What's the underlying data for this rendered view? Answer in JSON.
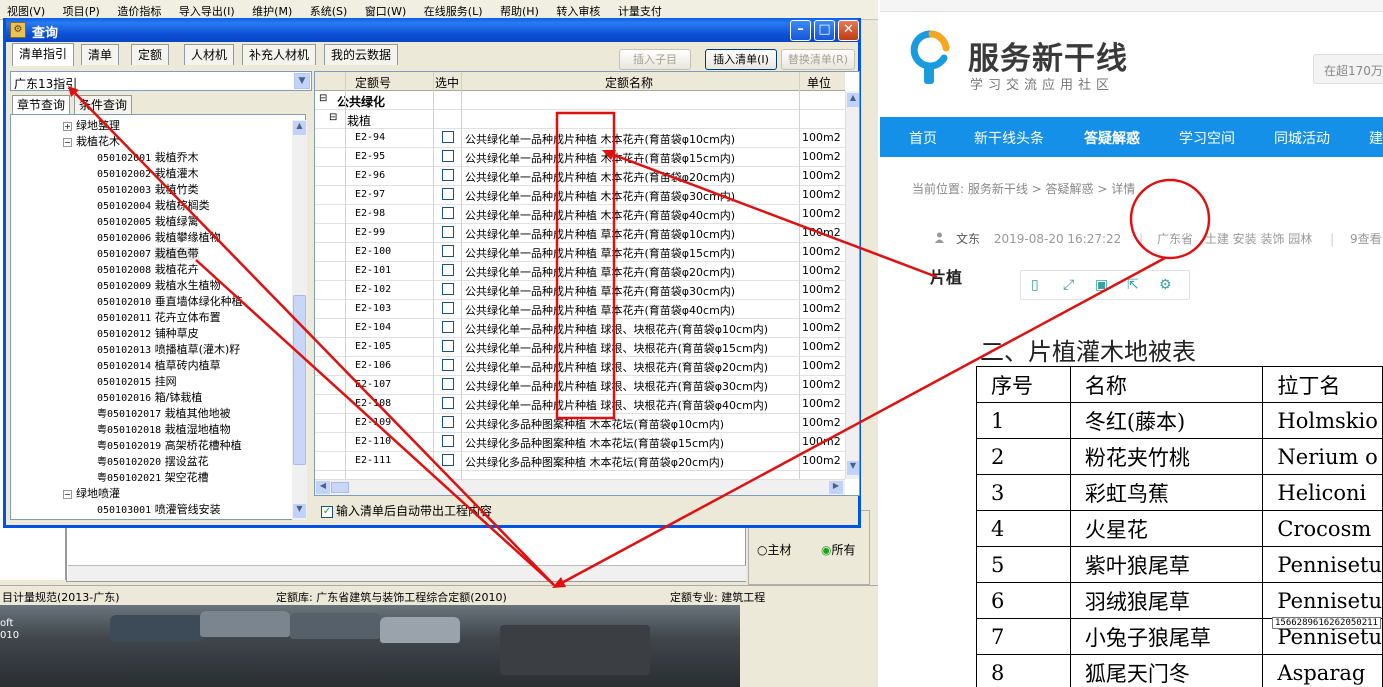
{
  "background_app": {
    "menu": [
      "视图(V)",
      "项目(P)",
      "造价指标",
      "导入导出(I)",
      "维护(M)",
      "系统(S)",
      "窗口(W)",
      "在线服务(L)",
      "帮助(H)",
      "转入审核",
      "计量支付"
    ],
    "status": {
      "left": "目计量规范(2013-广东)",
      "quota_lib": "定额库: 广东省建筑与装饰工程综合定额(2010)",
      "quota_major": "定额专业: 建筑工程"
    },
    "radio_main": "主材",
    "radio_all": "所有",
    "photo_text": [
      "oft",
      "010"
    ]
  },
  "dialog": {
    "title": "查询",
    "tabs": [
      "清单指引",
      "清单",
      "定额",
      "人材机",
      "补充人材机",
      "我的云数据"
    ],
    "buttons": {
      "insert_child": "插入子目",
      "insert_bill": "插入清单(I)",
      "replace_bill": "替换清单(R)"
    },
    "combo_value": "广东13指引",
    "subtabs": [
      "章节查询",
      "条件查询"
    ],
    "tree": [
      {
        "label": "绿地整理",
        "level": 1,
        "toggle": "+"
      },
      {
        "label": "栽植花木",
        "level": 1,
        "toggle": "-"
      },
      {
        "code": "050102001",
        "label": "栽植乔木",
        "level": 2
      },
      {
        "code": "050102002",
        "label": "栽植灌木",
        "level": 2
      },
      {
        "code": "050102003",
        "label": "栽植竹类",
        "level": 2
      },
      {
        "code": "050102004",
        "label": "栽植棕榈类",
        "level": 2
      },
      {
        "code": "050102005",
        "label": "栽植绿篱",
        "level": 2
      },
      {
        "code": "050102006",
        "label": "栽植攀缘植物",
        "level": 2
      },
      {
        "code": "050102007",
        "label": "栽植色带",
        "level": 2,
        "selected": true
      },
      {
        "code": "050102008",
        "label": "栽植花卉",
        "level": 2
      },
      {
        "code": "050102009",
        "label": "栽植水生植物",
        "level": 2
      },
      {
        "code": "050102010",
        "label": "垂直墙体绿化种植",
        "level": 2
      },
      {
        "code": "050102011",
        "label": "花卉立体布置",
        "level": 2
      },
      {
        "code": "050102012",
        "label": "铺种草皮",
        "level": 2
      },
      {
        "code": "050102013",
        "label": "喷播植草(灌木)籽",
        "level": 2
      },
      {
        "code": "050102014",
        "label": "植草砖内植草",
        "level": 2
      },
      {
        "code": "050102015",
        "label": "挂网",
        "level": 2
      },
      {
        "code": "050102016",
        "label": "箱/钵栽植",
        "level": 2
      },
      {
        "code": "粤050102017",
        "label": "栽植其他地被",
        "level": 2
      },
      {
        "code": "粤050102018",
        "label": "栽植湿地植物",
        "level": 2
      },
      {
        "code": "粤050102019",
        "label": "高架桥花槽种植",
        "level": 2
      },
      {
        "code": "粤050102020",
        "label": "摆设盆花",
        "level": 2
      },
      {
        "code": "粤050102021",
        "label": "架空花槽",
        "level": 2
      },
      {
        "label": "绿地喷灌",
        "level": 1,
        "toggle": "-"
      },
      {
        "code": "050103001",
        "label": "喷灌管线安装",
        "level": 2
      }
    ],
    "grid": {
      "headers": [
        "定额号",
        "选中",
        "定额名称",
        "单位"
      ],
      "group": "公共绿化",
      "subgroup": "栽植",
      "rows": [
        {
          "code": "E2-94",
          "name": "公共绿化单一品种成片种植 木本花卉(育苗袋φ10cm内)",
          "unit": "100m2"
        },
        {
          "code": "E2-95",
          "name": "公共绿化单一品种成片种植 木本花卉(育苗袋φ15cm内)",
          "unit": "100m2"
        },
        {
          "code": "E2-96",
          "name": "公共绿化单一品种成片种植 木本花卉(育苗袋φ20cm内)",
          "unit": "100m2"
        },
        {
          "code": "E2-97",
          "name": "公共绿化单一品种成片种植 木本花卉(育苗袋φ30cm内)",
          "unit": "100m2"
        },
        {
          "code": "E2-98",
          "name": "公共绿化单一品种成片种植 木本花卉(育苗袋φ40cm内)",
          "unit": "100m2"
        },
        {
          "code": "E2-99",
          "name": "公共绿化单一品种成片种植 草本花卉(育苗袋φ10cm内)",
          "unit": "100m2"
        },
        {
          "code": "E2-100",
          "name": "公共绿化单一品种成片种植 草本花卉(育苗袋φ15cm内)",
          "unit": "100m2"
        },
        {
          "code": "E2-101",
          "name": "公共绿化单一品种成片种植 草本花卉(育苗袋φ20cm内)",
          "unit": "100m2"
        },
        {
          "code": "E2-102",
          "name": "公共绿化单一品种成片种植 草本花卉(育苗袋φ30cm内)",
          "unit": "100m2"
        },
        {
          "code": "E2-103",
          "name": "公共绿化单一品种成片种植 草本花卉(育苗袋φ40cm内)",
          "unit": "100m2"
        },
        {
          "code": "E2-104",
          "name": "公共绿化单一品种成片种植 球根、块根花卉(育苗袋φ10cm内)",
          "unit": "100m2"
        },
        {
          "code": "E2-105",
          "name": "公共绿化单一品种成片种植 球根、块根花卉(育苗袋φ15cm内)",
          "unit": "100m2"
        },
        {
          "code": "E2-106",
          "name": "公共绿化单一品种成片种植 球根、块根花卉(育苗袋φ20cm内)",
          "unit": "100m2"
        },
        {
          "code": "E2-107",
          "name": "公共绿化单一品种成片种植 球根、块根花卉(育苗袋φ30cm内)",
          "unit": "100m2"
        },
        {
          "code": "E2-108",
          "name": "公共绿化单一品种成片种植 球根、块根花卉(育苗袋φ40cm内)",
          "unit": "100m2"
        },
        {
          "code": "E2-109",
          "name": "公共绿化多品种图案种植 木本花坛(育苗袋φ10cm内)",
          "unit": "100m2"
        },
        {
          "code": "E2-110",
          "name": "公共绿化多品种图案种植 木本花坛(育苗袋φ15cm内)",
          "unit": "100m2"
        },
        {
          "code": "E2-111",
          "name": "公共绿化多品种图案种植 木本花坛(育苗袋φ20cm内)",
          "unit": "100m2"
        }
      ]
    },
    "auto_checkbox": "输入清单后自动带出工程内容"
  },
  "website": {
    "logo_title": "服务新干线",
    "logo_sub": "学习交流应用社区",
    "search_placeholder": "在超170万",
    "nav": [
      "首页",
      "新干线头条",
      "答疑解惑",
      "学习空间",
      "同城活动",
      "建"
    ],
    "breadcrumb": "当前位置: 服务新干线 > 答疑解惑 > 详情",
    "meta": {
      "author": "文东",
      "date": "2019-08-20 16:27:22",
      "region": "广东省",
      "tags": "土建 安装 装饰 园林",
      "views": "9查看"
    },
    "heading": "片植",
    "section_title": "二、片植灌木地被表",
    "table": {
      "headers": [
        "序号",
        "名称",
        "拉丁名"
      ],
      "rows": [
        [
          "1",
          "冬红(藤本)",
          "Holmskio"
        ],
        [
          "2",
          "粉花夹竹桃",
          "Nerium o"
        ],
        [
          "3",
          "彩虹鸟蕉",
          "Heliconi"
        ],
        [
          "4",
          "火星花",
          "Crocosm"
        ],
        [
          "5",
          "紫叶狼尾草",
          "Pennisetu"
        ],
        [
          "6",
          "羽绒狼尾草",
          "Pennisetu"
        ],
        [
          "7",
          "小兔子狼尾草",
          "Pennisetu"
        ],
        [
          "8",
          "狐尾天门冬",
          "Asparag"
        ]
      ]
    },
    "tooltip_id": "1566289616262050211"
  },
  "colors": {
    "annotation": "#e01010",
    "xp_blue": "#0054e3",
    "nav_blue": "#1590e8"
  }
}
